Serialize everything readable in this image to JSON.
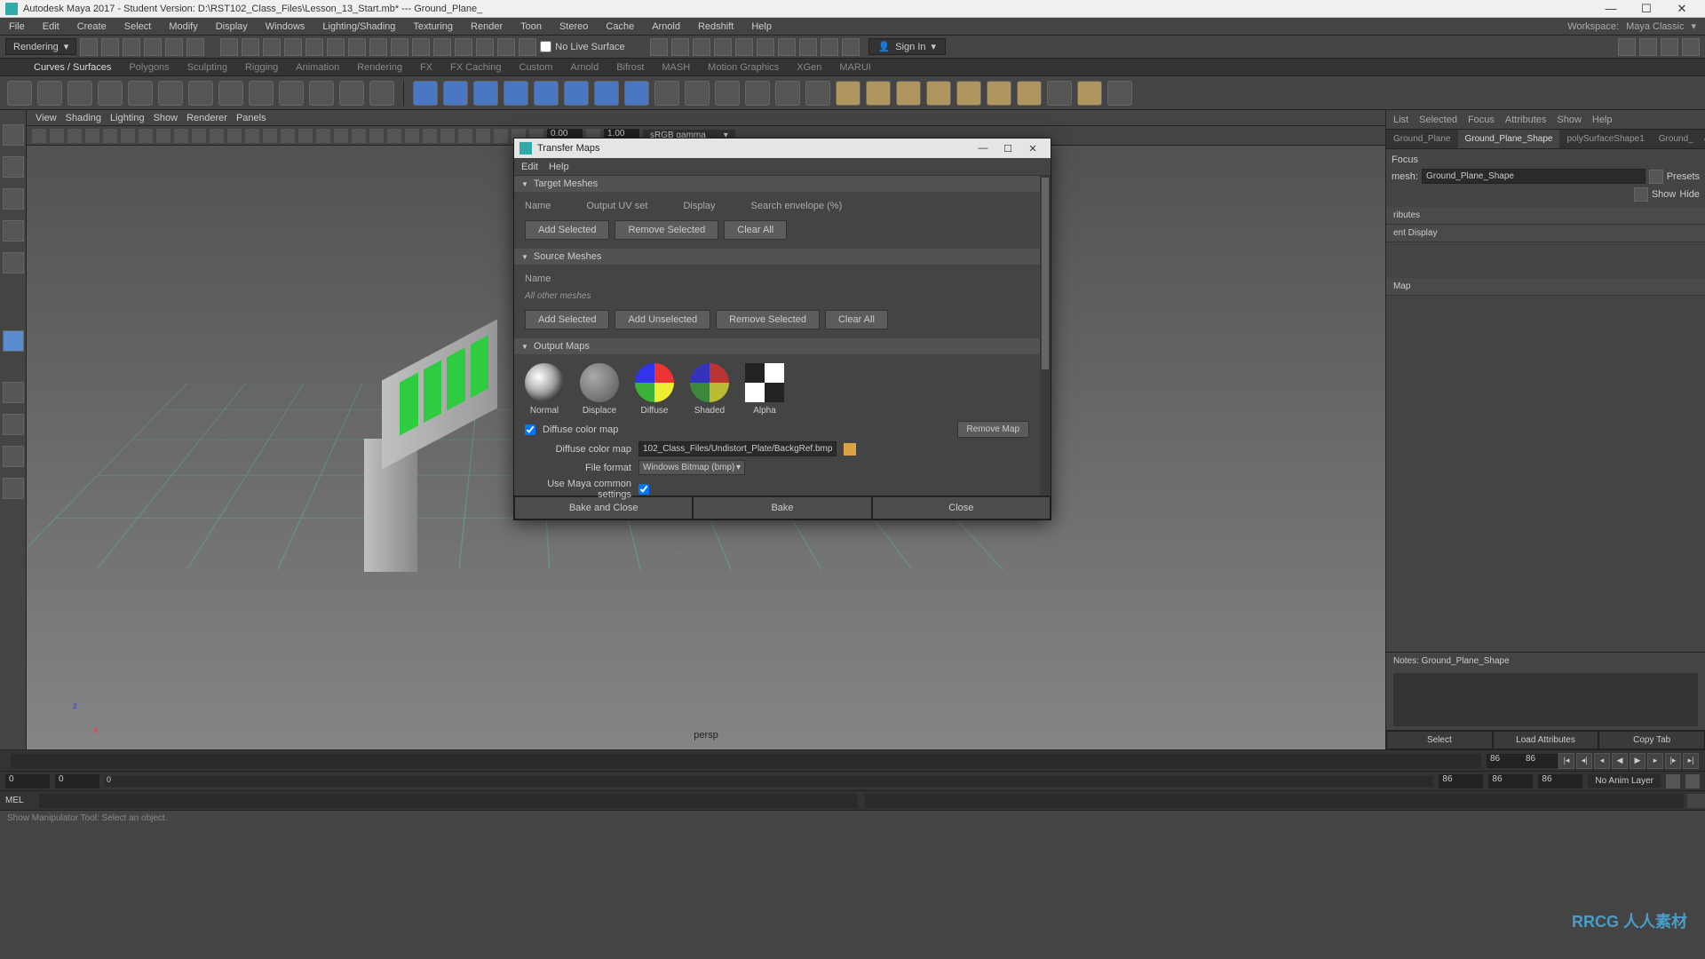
{
  "window": {
    "title": "Autodesk Maya 2017 - Student Version: D:\\RST102_Class_Files\\Lesson_13_Start.mb* --- Ground_Plane_"
  },
  "menus": [
    "File",
    "Edit",
    "Create",
    "Select",
    "Modify",
    "Display",
    "Windows",
    "Lighting/Shading",
    "Texturing",
    "Render",
    "Toon",
    "Stereo",
    "Cache",
    "Arnold",
    "Redshift",
    "Help"
  ],
  "workspace": {
    "label": "Workspace:",
    "value": "Maya Classic"
  },
  "mode_dropdown": "Rendering",
  "no_live_surface": "No Live Surface",
  "sign_in": "Sign In",
  "shelf_tabs": [
    "Curves / Surfaces",
    "Polygons",
    "Sculpting",
    "Rigging",
    "Animation",
    "Rendering",
    "FX",
    "FX Caching",
    "Custom",
    "Arnold",
    "Bifrost",
    "MASH",
    "Motion Graphics",
    "XGen",
    "MARUI"
  ],
  "viewport": {
    "menus": [
      "View",
      "Shading",
      "Lighting",
      "Show",
      "Renderer",
      "Panels"
    ],
    "time_a": "0.00",
    "time_b": "1.00",
    "gamma_dd": "sRGB gamma",
    "persp": "persp"
  },
  "right": {
    "menus": [
      "List",
      "Selected",
      "Focus",
      "Attributes",
      "Show",
      "Help"
    ],
    "tabs": [
      "Ground_Plane",
      "Ground_Plane_Shape",
      "polySurfaceShape1",
      "Ground_"
    ],
    "active_tab": 1,
    "focus": "Focus",
    "presets": "Presets",
    "show": "Show",
    "hide": "Hide",
    "mesh_label": "mesh:",
    "mesh_value": "Ground_Plane_Shape",
    "sections": [
      "ributes",
      "ent Display",
      "Map"
    ],
    "notes_label": "Notes: Ground_Plane_Shape",
    "buttons": [
      "Select",
      "Load Attributes",
      "Copy Tab"
    ]
  },
  "timeline": {
    "current": "86",
    "range_start": "0",
    "range_end": "0",
    "inner_start": "0",
    "outer_a": "86",
    "outer_b": "86",
    "outer_c": "86",
    "layer_dd": "No Anim Layer"
  },
  "cmdline": {
    "lang": "MEL"
  },
  "helpline": "Show Manipulator Tool: Select an object.",
  "dialog": {
    "title": "Transfer Maps",
    "menus": [
      "Edit",
      "Help"
    ],
    "sections": {
      "target": {
        "title": "Target Meshes",
        "cols": [
          "Name",
          "Output UV set",
          "Display",
          "Search envelope (%)"
        ],
        "buttons": [
          "Add Selected",
          "Remove Selected",
          "Clear All"
        ]
      },
      "source": {
        "title": "Source Meshes",
        "cols": [
          "Name"
        ],
        "all_other": "All other meshes",
        "buttons": [
          "Add Selected",
          "Add Unselected",
          "Remove Selected",
          "Clear All"
        ]
      },
      "output": {
        "title": "Output Maps",
        "maps": [
          "Normal",
          "Displace",
          "Diffuse",
          "Shaded",
          "Alpha"
        ],
        "diffuse_check": "Diffuse color map",
        "remove_map": "Remove Map",
        "path_label": "Diffuse color map",
        "path_value": "102_Class_Files/Undistort_Plate/BackgRef.bmp",
        "format_label": "File format",
        "format_value": "Windows Bitmap (bmp)",
        "common_label": "Use Maya common settings"
      }
    },
    "buttons": [
      "Bake and Close",
      "Bake",
      "Close"
    ]
  },
  "watermark": "RRCG\n人人素材"
}
